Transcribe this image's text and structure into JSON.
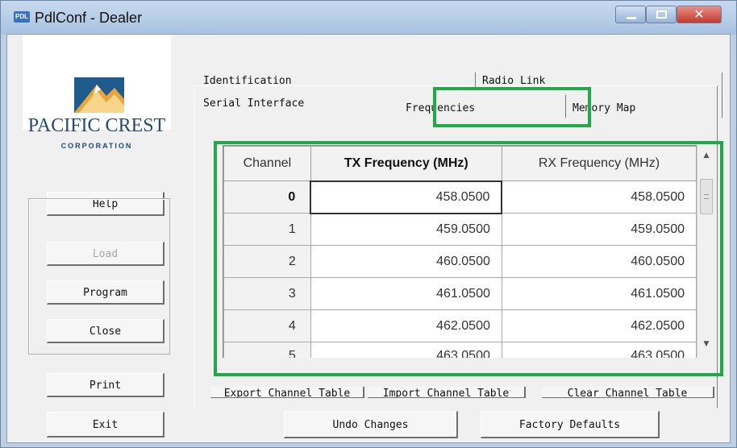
{
  "window": {
    "icon_text": "PDL",
    "title": "PdlConf - Dealer"
  },
  "logo": {
    "name": "PACIFIC CREST",
    "subtitle": "CORPORATION"
  },
  "side_buttons": {
    "help": "Help",
    "load": "Load",
    "program": "Program",
    "close": "Close",
    "print": "Print",
    "exit": "Exit"
  },
  "tabs": {
    "identification": "Identification",
    "radio_link": "Radio Link",
    "serial_interface": "Serial Interface",
    "frequencies": "Frequencies",
    "memory_map": "Memory Map"
  },
  "grid": {
    "headers": [
      "Channel",
      "TX Frequency (MHz)",
      "RX Frequency (MHz)"
    ],
    "rows": [
      {
        "channel": "0",
        "tx": "458.0500",
        "rx": "458.0500"
      },
      {
        "channel": "1",
        "tx": "459.0500",
        "rx": "459.0500"
      },
      {
        "channel": "2",
        "tx": "460.0500",
        "rx": "460.0500"
      },
      {
        "channel": "3",
        "tx": "461.0500",
        "rx": "461.0500"
      },
      {
        "channel": "4",
        "tx": "462.0500",
        "rx": "462.0500"
      },
      {
        "channel": "5",
        "tx": "463.0500",
        "rx": "463.0500"
      }
    ]
  },
  "table_buttons": {
    "export": "Export Channel Table",
    "import": "Import Channel Table",
    "clear": "Clear Channel Table"
  },
  "bottom_buttons": {
    "undo": "Undo Changes",
    "factory": "Factory Defaults"
  },
  "colors": {
    "highlight": "#1faa4a",
    "title_bar": "#bfd3ec",
    "close_button": "#c9453a"
  }
}
